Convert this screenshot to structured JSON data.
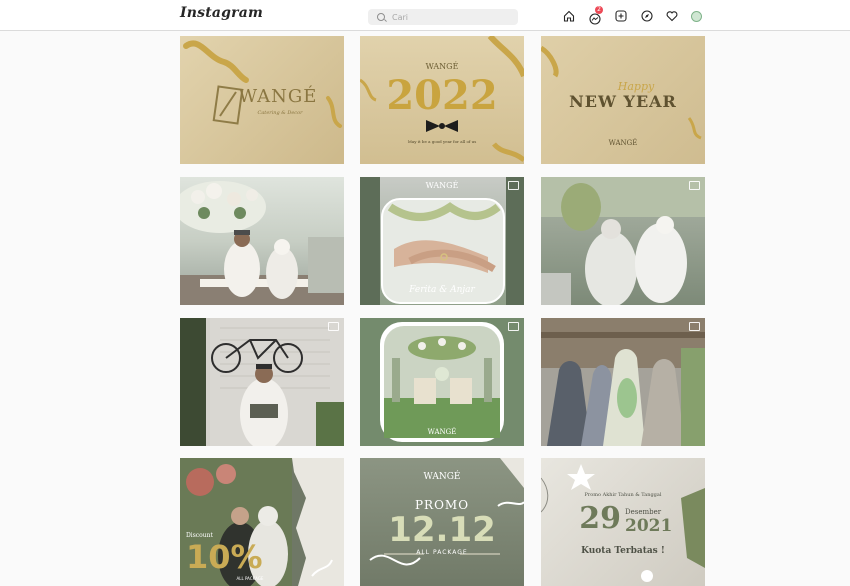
{
  "app": {
    "name": "Instagram"
  },
  "search": {
    "placeholder": "Cari"
  },
  "nav": {
    "icons": [
      "home-icon",
      "messenger-icon",
      "new-post-icon",
      "explore-icon",
      "activity-heart-icon",
      "profile-avatar"
    ],
    "messages_badge": "2"
  },
  "colors": {
    "cream": "#d6c49a",
    "gold": "#c9a64a",
    "sage": "#6f7a63",
    "notification": "#ed4956"
  },
  "posts": [
    {
      "brand": "WANGÉ",
      "tagline": "Catering & Decor"
    },
    {
      "brand": "WANGÉ",
      "year": "2022",
      "caption": "May it be a good year for all of us"
    },
    {
      "script": "Happy",
      "headline": "NEW YEAR",
      "brand": "WANGÉ"
    },
    {},
    {
      "brand": "WANGÉ",
      "names": "Ferita & Anjar"
    },
    {},
    {},
    {
      "brand": "WANGÉ"
    },
    {},
    {
      "label": "Discount",
      "percent": "10%",
      "sub": "ALL PACKAGE"
    },
    {
      "brand": "WANGÉ",
      "promo": "PROMO",
      "date": "12.12",
      "package": "ALL PACKAGE"
    },
    {
      "intro": "Promo Akhir Tahun & Tanggal",
      "day": "29",
      "month": "Desember",
      "year": "2021",
      "quota": "Kuota Terbatas !"
    }
  ]
}
